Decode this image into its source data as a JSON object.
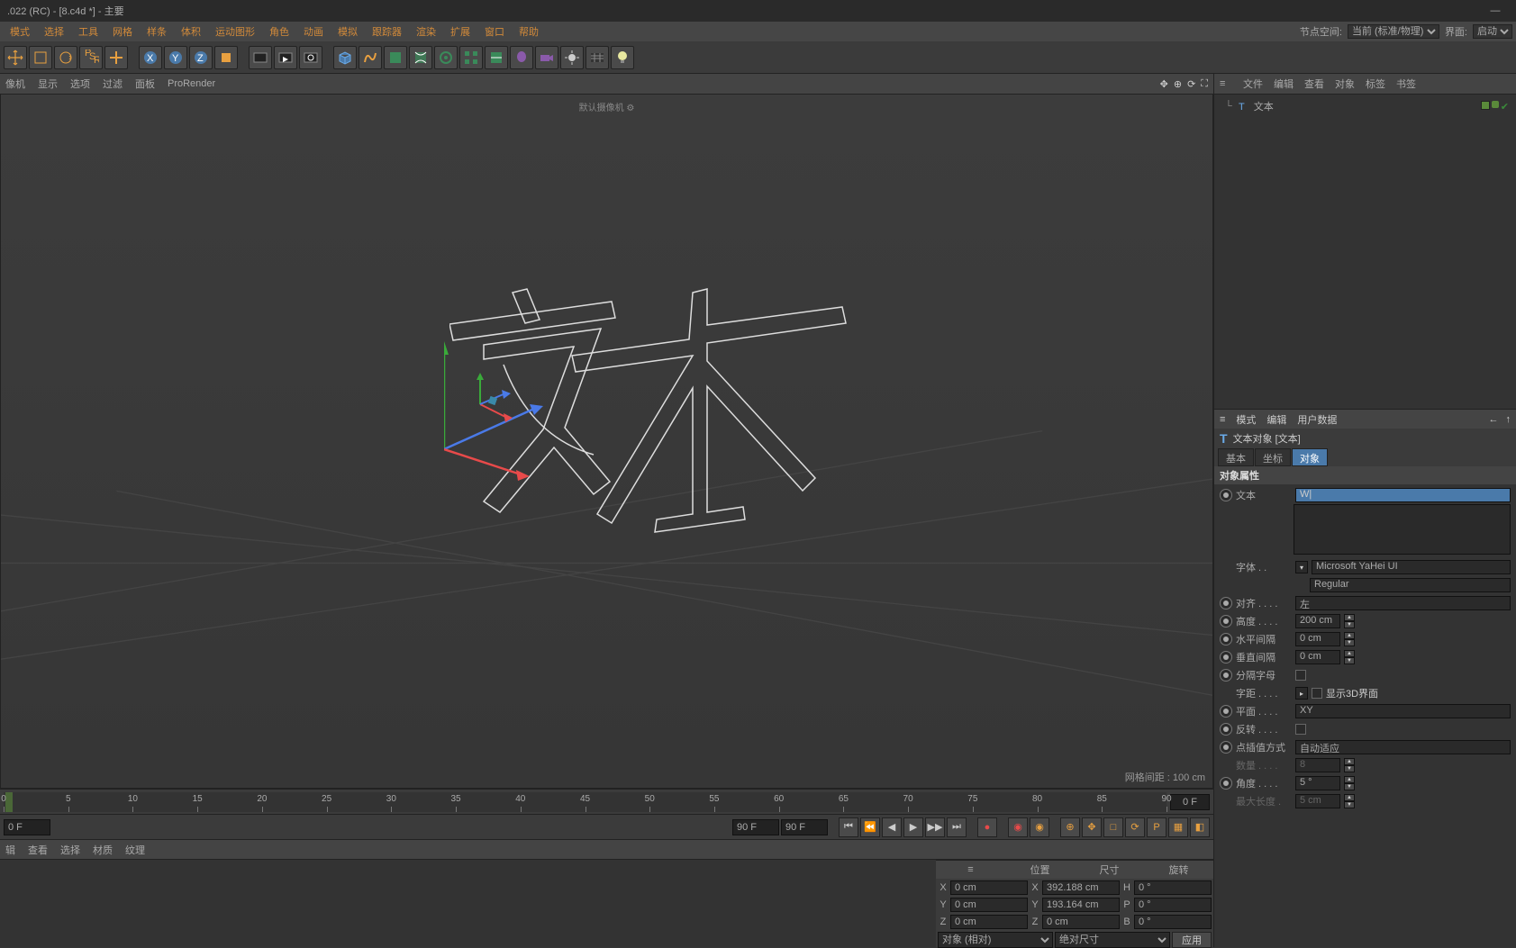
{
  "title": ".022 (RC) - [8.c4d *] - 主要",
  "menubar": {
    "items": [
      "模式",
      "选择",
      "工具",
      "网格",
      "样条",
      "体积",
      "运动图形",
      "角色",
      "动画",
      "模拟",
      "跟踪器",
      "渲染",
      "扩展",
      "窗口",
      "帮助"
    ],
    "nodespace_label": "节点空间:",
    "nodespace_value": "当前 (标准/物理)",
    "layout_label": "界面:",
    "layout_value": "启动"
  },
  "viewport_tabs": [
    "像机",
    "显示",
    "选项",
    "过滤",
    "面板",
    "ProRender"
  ],
  "viewport": {
    "camera_label": "默认摄像机 ⚙",
    "grid_label": "网格间距 : 100 cm"
  },
  "timeline": {
    "start": "0 F",
    "end": "90 F",
    "current": "0 F",
    "endfield": "90 F",
    "ticks": [
      0,
      5,
      10,
      15,
      20,
      25,
      30,
      35,
      40,
      45,
      50,
      55,
      60,
      65,
      70,
      75,
      80,
      85,
      90
    ]
  },
  "bottom_tabs": [
    "辑",
    "查看",
    "选择",
    "材质",
    "纹理"
  ],
  "coord": {
    "headers": [
      "位置",
      "尺寸",
      "旋转"
    ],
    "rows": [
      {
        "axis": "X",
        "pos": "0 cm",
        "size": "392.188 cm",
        "rot_label": "H",
        "rot": "0 °"
      },
      {
        "axis": "Y",
        "pos": "0 cm",
        "size": "193.164 cm",
        "rot_label": "P",
        "rot": "0 °"
      },
      {
        "axis": "Z",
        "pos": "0 cm",
        "size": "0 cm",
        "rot_label": "B",
        "rot": "0 °"
      }
    ],
    "mode1": "对象 (相对)",
    "mode2": "绝对尺寸",
    "apply": "应用"
  },
  "obj_menu": [
    "文件",
    "编辑",
    "查看",
    "对象",
    "标签",
    "书签"
  ],
  "obj_tree": {
    "name": "文本"
  },
  "att_menu": [
    "模式",
    "编辑",
    "用户数据"
  ],
  "att_head": "文本对象 [文本]",
  "att_tabs": [
    "基本",
    "坐标",
    "对象"
  ],
  "att_section": "对象属性",
  "props": {
    "text_label": "文本",
    "text_value": "W",
    "font_label": "字体 . .",
    "font_value": "Microsoft YaHei UI",
    "font_style": "Regular",
    "align_label": "对齐 . . . .",
    "align_value": "左",
    "height_label": "高度 . . . .",
    "height_value": "200 cm",
    "hspace_label": "水平间隔",
    "hspace_value": "0 cm",
    "vspace_label": "垂直间隔",
    "vspace_value": "0 cm",
    "sep_label": "分隔字母",
    "kerning_label": "字距 . . . .",
    "show3d_label": "显示3D界面",
    "plane_label": "平面 . . . .",
    "plane_value": "XY",
    "reverse_label": "反转 . . . .",
    "interp_label": "点插值方式",
    "interp_value": "自动适应",
    "count_label": "数量 . . . .",
    "count_value": "8",
    "angle_label": "角度 . . . .",
    "angle_value": "5 °",
    "maxlen_label": "最大长度 .",
    "maxlen_value": "5 cm"
  }
}
